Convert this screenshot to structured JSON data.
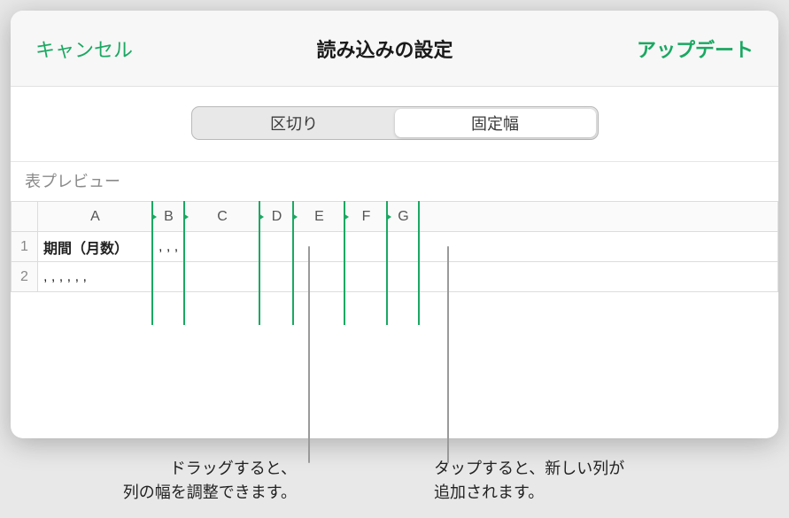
{
  "header": {
    "cancel": "キャンセル",
    "title": "読み込みの設定",
    "update": "アップデート"
  },
  "segmented": {
    "delimited": "区切り",
    "fixed": "固定幅",
    "active": "fixed"
  },
  "preview_label": "表プレビュー",
  "columns": [
    {
      "label": "A",
      "handle": false,
      "width": 130
    },
    {
      "label": "B",
      "handle": true,
      "width": 36
    },
    {
      "label": "C",
      "handle": true,
      "width": 85
    },
    {
      "label": "D",
      "handle": true,
      "width": 38
    },
    {
      "label": "E",
      "handle": true,
      "width": 58
    },
    {
      "label": "F",
      "handle": true,
      "width": 48
    },
    {
      "label": "G",
      "handle": true,
      "width": 36
    }
  ],
  "rows": [
    {
      "n": "1",
      "cells": [
        "期間（月数）",
        ", , , , ,",
        "",
        "",
        "",
        "",
        ""
      ]
    },
    {
      "n": "2",
      "cells": [
        ", , , , , ,",
        "",
        "",
        "",
        "",
        "",
        ""
      ]
    }
  ],
  "callouts": {
    "drag": "ドラッグすると、\n列の幅を調整できます。",
    "tap": "タップすると、新しい列が\n追加されます。"
  }
}
